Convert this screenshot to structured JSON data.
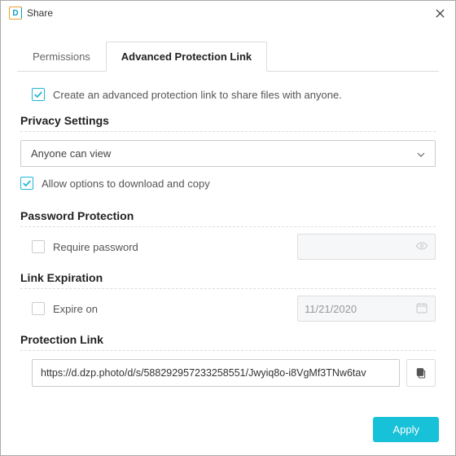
{
  "window": {
    "title": "Share"
  },
  "tabs": {
    "permissions": "Permissions",
    "advanced": "Advanced Protection Link"
  },
  "create_link_label": "Create an advanced protection link to share files with anyone.",
  "privacy": {
    "title": "Privacy Settings",
    "selected": "Anyone can view",
    "allow_download_copy": "Allow options to download and copy"
  },
  "password": {
    "title": "Password Protection",
    "require_label": "Require password"
  },
  "expiration": {
    "title": "Link Expiration",
    "expire_on_label": "Expire on",
    "date_value": "11/21/2020"
  },
  "protection_link": {
    "title": "Protection Link",
    "url": "https://d.dzp.photo/d/s/588292957233258551/Jwyiq8o-i8VgMf3TNw6tav"
  },
  "footer": {
    "apply": "Apply"
  }
}
